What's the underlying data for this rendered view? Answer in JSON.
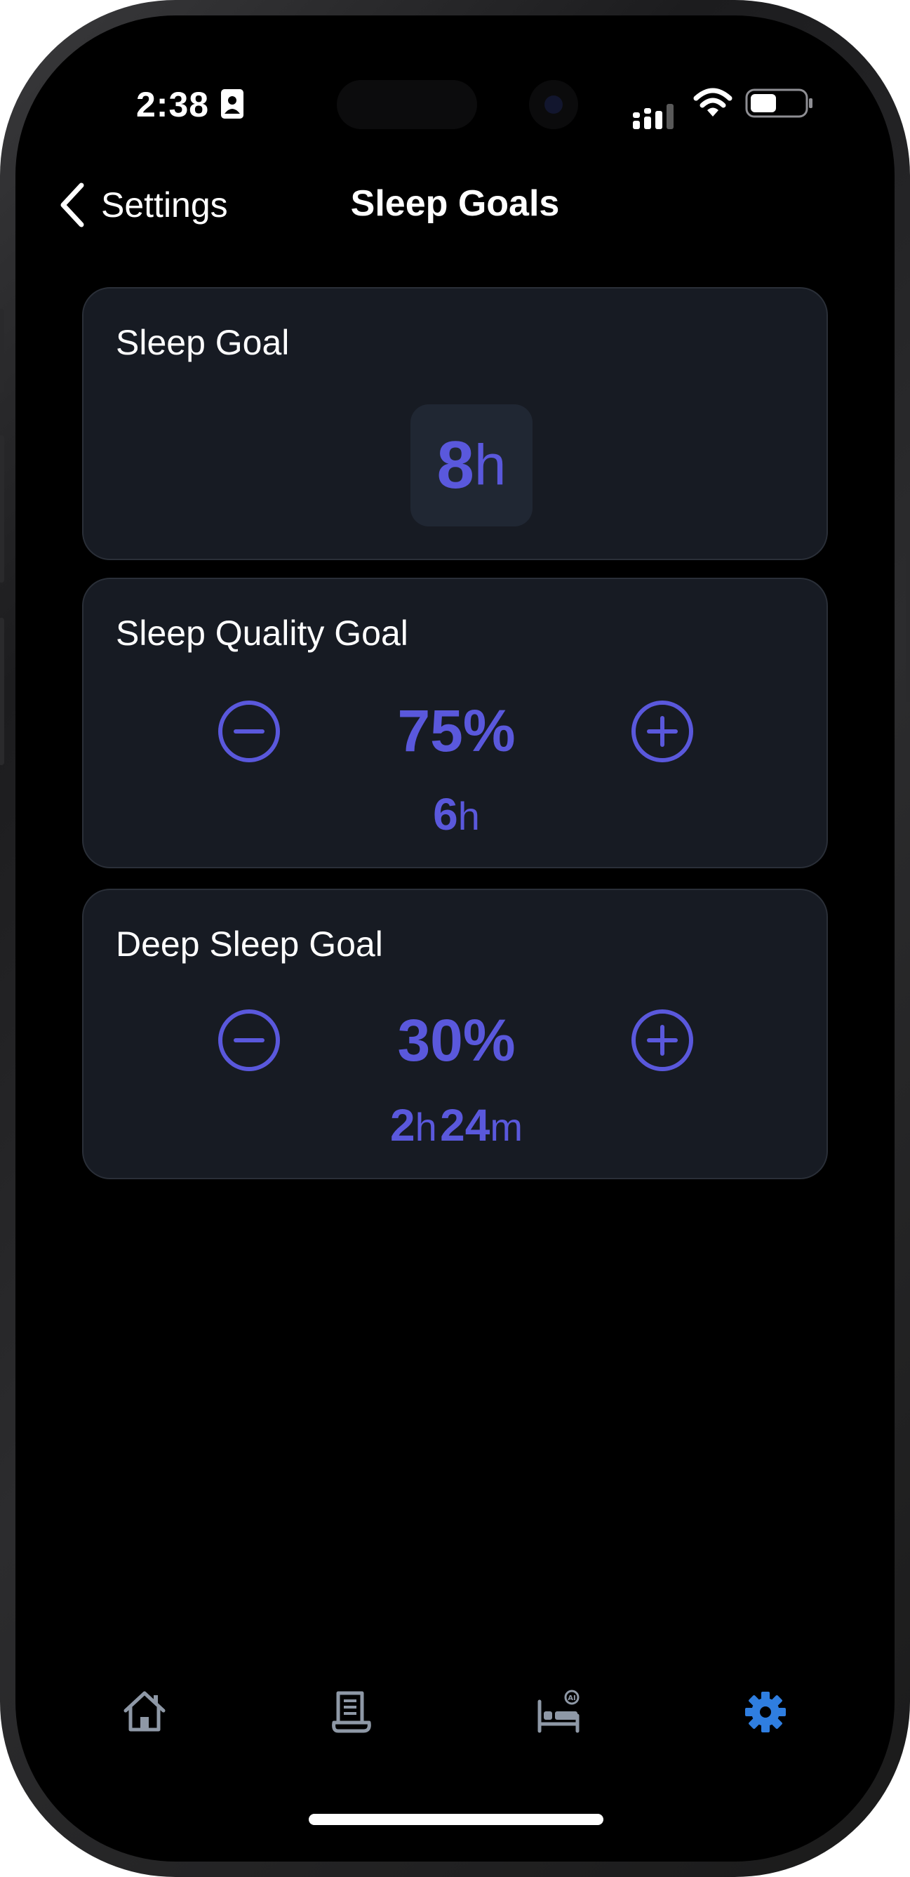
{
  "status_bar": {
    "time": "2:38",
    "icons": [
      "contact-card-icon",
      "cellular-signal-icon",
      "wifi-icon",
      "battery-icon"
    ]
  },
  "nav": {
    "back_label": "Settings",
    "title": "Sleep Goals"
  },
  "cards": {
    "sleep_goal": {
      "title": "Sleep Goal",
      "value_num": "8",
      "value_unit": "h"
    },
    "quality_goal": {
      "title": "Sleep Quality Goal",
      "percent": "75%",
      "sub_num": "6",
      "sub_unit": "h"
    },
    "deep_goal": {
      "title": "Deep Sleep Goal",
      "percent": "30%",
      "sub_hours_num": "2",
      "sub_hours_unit": "h",
      "sub_min_num": "24",
      "sub_min_unit": "m"
    }
  },
  "tab_bar": {
    "tabs": [
      {
        "icon": "home-icon",
        "active": false
      },
      {
        "icon": "journal-icon",
        "active": false
      },
      {
        "icon": "bed-ai-icon",
        "active": false
      },
      {
        "icon": "settings-gear-icon",
        "active": true
      }
    ]
  },
  "colors": {
    "background": "#000000",
    "card": "#171b23",
    "accent": "#5a58dc",
    "tab_active": "#2f7ee0",
    "tab_inactive": "#8e98a6"
  }
}
